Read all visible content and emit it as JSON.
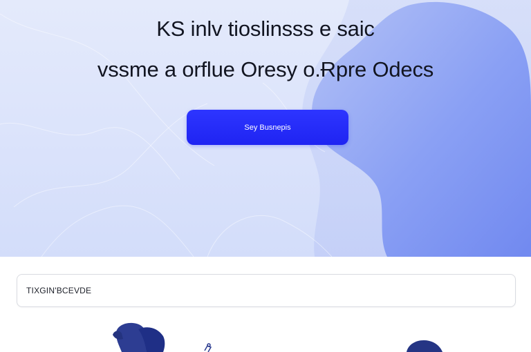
{
  "hero": {
    "headline_line1": "KS  inlv tioslinsss e saic",
    "headline_line2": "vssme a orflue Oresy o.Ɍpre Odecs",
    "cta_label": "Sey Busnepis"
  },
  "search": {
    "value": "TIXGIN'BCEVDE"
  },
  "colors": {
    "hero_background": "#dbe3fb",
    "accent_blob": "#7c93f3",
    "cta_background": "#2128f6",
    "text_primary": "#121521",
    "illustration_navy": "#2a3a8f"
  }
}
